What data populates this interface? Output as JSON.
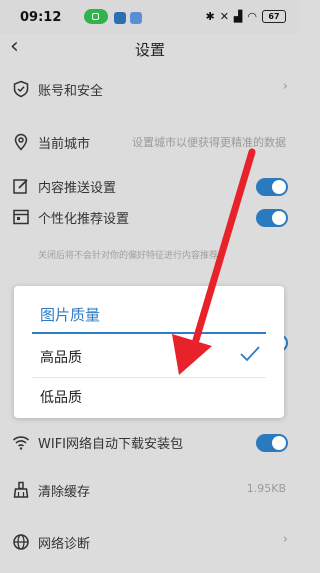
{
  "status_bar": {
    "time": "09:12",
    "battery": "67"
  },
  "header": {
    "title": "设置"
  },
  "settings": {
    "account_security": "账号和安全",
    "current_city": "当前城市",
    "current_city_hint": "设置城市以便获得更精准的数据",
    "push_settings": "内容推送设置",
    "personalized": "个性化推荐设置",
    "personalized_hint": "关闭后将不会针对你的偏好特征进行内容推荐",
    "wifi_download": "WIFI网络自动下载安装包",
    "clear_cache": "清除缓存",
    "cache_size": "1.95KB",
    "network_diagnosis": "网络诊断"
  },
  "dialog": {
    "title": "图片质量",
    "options": [
      {
        "label": "高品质",
        "selected": true
      },
      {
        "label": "低品质",
        "selected": false
      }
    ]
  },
  "colors": {
    "accent": "#2d7cc4",
    "toggle_on": "#2a7abf",
    "arrow": "#e8222a"
  },
  "icons": {
    "account_security": "shield-icon",
    "current_city": "location-pin-icon",
    "push_settings": "edit-icon",
    "personalized": "window-icon",
    "wifi_download": "wifi-icon",
    "clear_cache": "broom-icon",
    "network_diagnosis": "globe-icon"
  }
}
